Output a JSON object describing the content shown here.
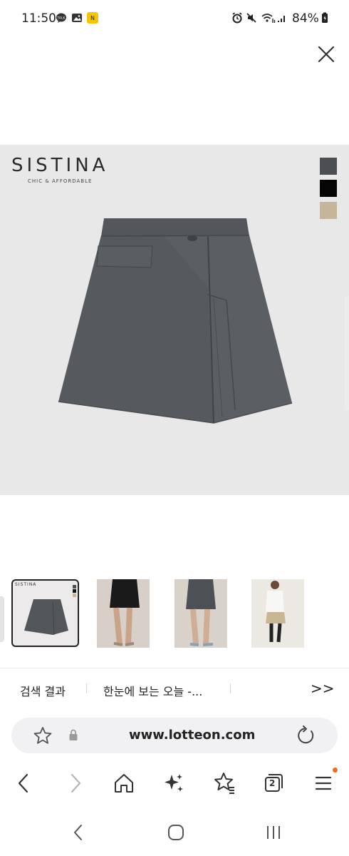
{
  "status_bar": {
    "time": "11:50",
    "battery": "84%",
    "icons": [
      "talk-notification-icon",
      "image-notification-icon",
      "app-notification-icon",
      "alarm-icon",
      "mute-icon",
      "wifi-icon",
      "signal-icon",
      "battery-icon"
    ]
  },
  "product": {
    "brand": "SISTINA",
    "tagline": "CHIC & AFFORDABLE",
    "color_swatches": [
      "#4b4e53",
      "#050505",
      "#c6b699"
    ]
  },
  "thumbnails": {
    "first_brand": "SISTINA",
    "items": [
      "thumb-flat-gray",
      "thumb-model-black",
      "thumb-model-gray",
      "thumb-model-beige"
    ]
  },
  "tabs": {
    "items": [
      "검색 결과",
      "한눈에 보는 오늘 -..."
    ],
    "more": ">>"
  },
  "address_bar": {
    "url": "www.lotteon.com"
  },
  "toolbar": {
    "tab_count": "2",
    "icons": [
      "back-icon",
      "forward-icon",
      "home-icon",
      "sparkle-icon",
      "bookmark-star-icon",
      "tabs-icon",
      "menu-icon"
    ]
  },
  "system_nav": [
    "recents-icon",
    "home-circle-icon",
    "back-nav-icon"
  ]
}
